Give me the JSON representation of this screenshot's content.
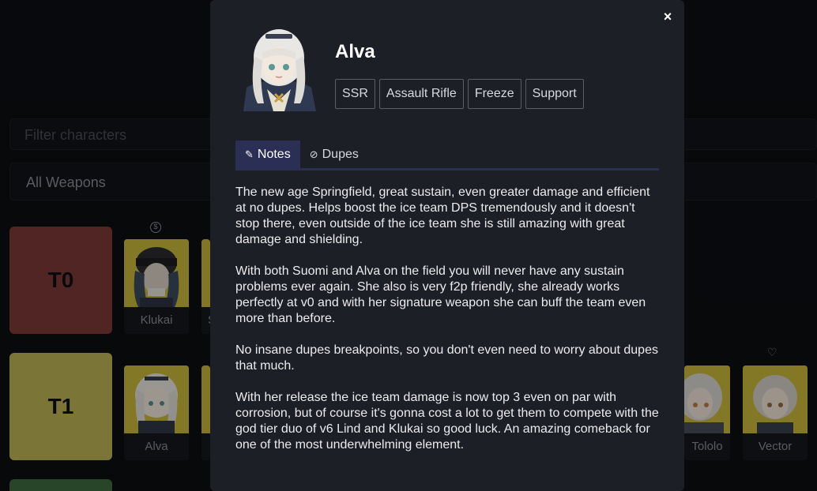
{
  "background": {
    "filter_placeholder": "Filter characters",
    "weapons_select": "All Weapons",
    "tiers": [
      "T0",
      "T1"
    ],
    "characters": [
      {
        "name": "Klukai"
      },
      {
        "name": "Alva"
      },
      {
        "name": "Tololo"
      },
      {
        "name": "Vector"
      }
    ],
    "partial_name": "S"
  },
  "modal": {
    "close_label": "×",
    "character_name": "Alva",
    "tags": [
      "SSR",
      "Assault Rifle",
      "Freeze",
      "Support"
    ],
    "tabs": [
      {
        "label": "Notes",
        "icon": "notes-icon",
        "active": true
      },
      {
        "label": "Dupes",
        "icon": "dupes-icon",
        "active": false
      }
    ],
    "notes": [
      "The new age Springfield, great sustain, even greater damage and efficient at no dupes. Helps boost the ice team DPS tremendously and it doesn't stop there, even outside of the ice team she is still amazing with great damage and shielding.",
      "With both Suomi and Alva on the field you will never have any sustain problems ever again. She also is very f2p friendly, she already works perfectly at v0 and with her signature weapon she can buff the team even more than before.",
      "No insane dupes breakpoints, so you don't even need to worry about dupes that much.",
      "With her release the ice team damage is now top 3 even on par with corrosion, but of course it's gonna cost a lot to get them to compete with the god tier duo of v6 Lind and Klukai so good luck. An amazing comeback for one of the most underwhelming element."
    ]
  },
  "colors": {
    "t0": "#7e3a3a",
    "t1": "#bfb457",
    "accent_tab": "#2c2f55",
    "modal_bg": "#1d1f26"
  }
}
